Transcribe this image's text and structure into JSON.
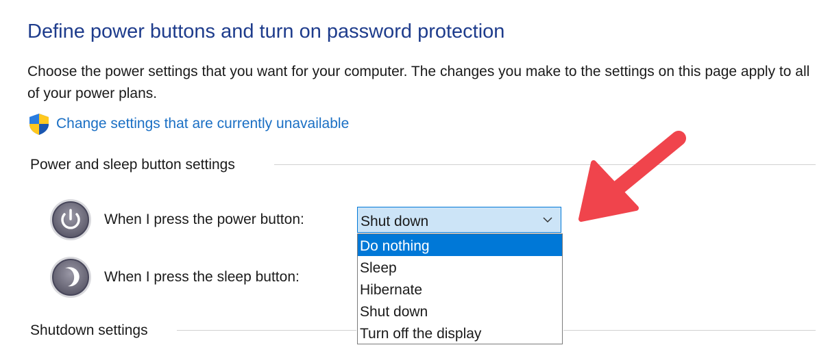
{
  "page": {
    "title": "Define power buttons and turn on password protection",
    "description": "Choose the power settings that you want for your computer. The changes you make to the settings on this page apply to all of your power plans."
  },
  "uac_link": {
    "label": "Change settings that are currently unavailable",
    "icon": "uac-shield-icon"
  },
  "power_sleep_group": {
    "header": "Power and sleep button settings",
    "rows": [
      {
        "label": "When I press the power button:",
        "icon": "power-button-icon",
        "value": "Shut down"
      },
      {
        "label": "When I press the sleep button:",
        "icon": "sleep-button-icon"
      }
    ]
  },
  "dropdown": {
    "options": [
      "Do nothing",
      "Sleep",
      "Hibernate",
      "Shut down",
      "Turn off the display"
    ],
    "highlighted": "Do nothing"
  },
  "shutdown_group": {
    "header": "Shutdown settings"
  },
  "colors": {
    "title": "#1e3c8c",
    "link": "#1a6fc4",
    "accent": "#0078d7",
    "annotation_arrow": "#f0444c"
  }
}
